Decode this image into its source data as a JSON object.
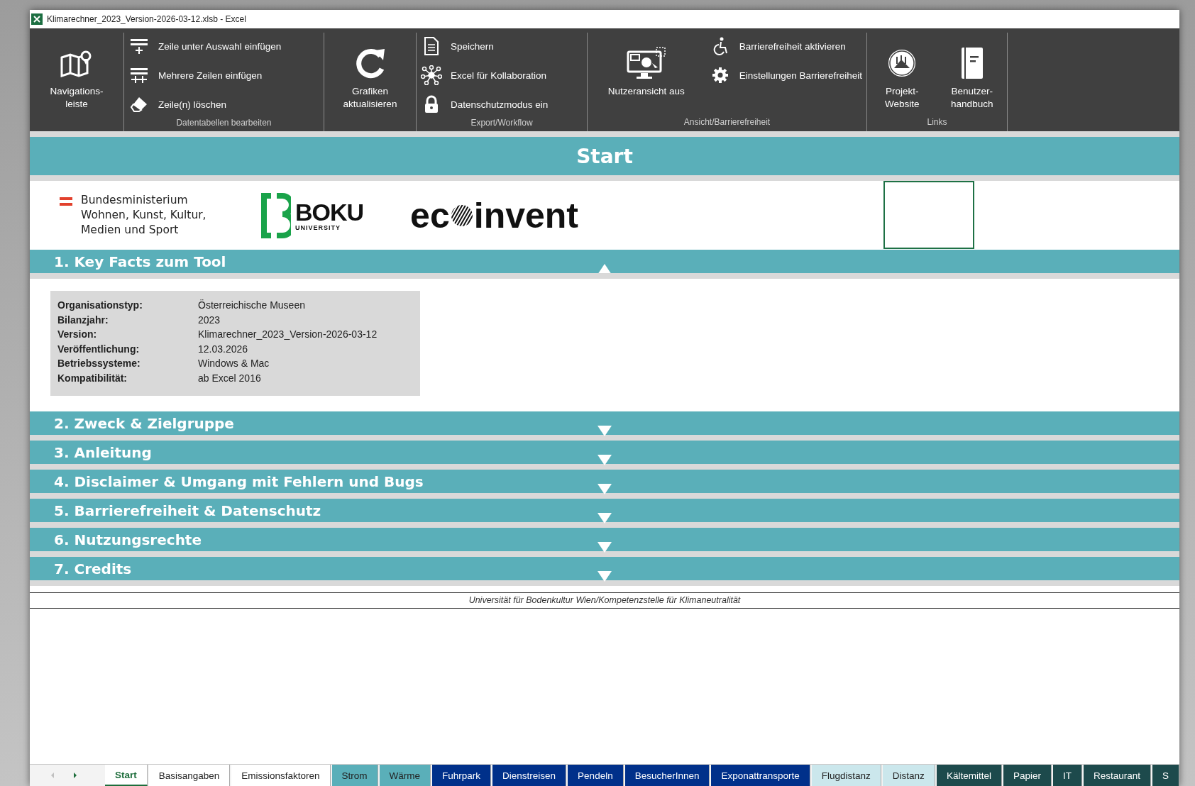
{
  "window": {
    "title": "Klimarechner_2023_Version-2026-03-12.xlsb - Excel"
  },
  "ribbon": {
    "groups": [
      {
        "buttons": [
          {
            "kind": "large",
            "label": "Navigations-\nleiste"
          }
        ]
      },
      {
        "label": "Datentabellen bearbeiten",
        "buttons": [
          {
            "kind": "small",
            "label": "Zeile unter Auswahl einfügen"
          },
          {
            "kind": "small",
            "label": "Mehrere Zeilen einfügen"
          },
          {
            "kind": "small",
            "label": "Zeile(n) löschen"
          }
        ]
      },
      {
        "buttons": [
          {
            "kind": "large",
            "label": "Grafiken\naktualisieren"
          }
        ]
      },
      {
        "label": "Export/Workflow",
        "buttons": [
          {
            "kind": "small",
            "label": "Speichern"
          },
          {
            "kind": "small",
            "label": "Excel für Kollaboration"
          },
          {
            "kind": "small",
            "label": "Datenschutzmodus ein"
          }
        ]
      },
      {
        "label": "Ansicht/Barrierefreiheit",
        "buttons": [
          {
            "kind": "large",
            "label": "Nutzeransicht aus"
          },
          {
            "kind": "small",
            "label": "Barrierefreiheit aktivieren"
          },
          {
            "kind": "small",
            "label": "Einstellungen Barrierefreiheit"
          }
        ]
      },
      {
        "label": "Links",
        "buttons": [
          {
            "kind": "large",
            "label": "Projekt-\nWebsite"
          },
          {
            "kind": "large",
            "label": "Benutzer-\nhandbuch"
          }
        ]
      }
    ]
  },
  "sheet": {
    "title": "Start",
    "logos": {
      "ministry": "Bundesministerium\nWohnen, Kunst, Kultur,\nMedien und Sport",
      "boku_name": "BOKU",
      "boku_sub": "UNIVERSITY",
      "ecoinvent_start": "ec",
      "ecoinvent_end": "invent"
    },
    "sections": [
      {
        "title": "1. Key Facts zum Tool",
        "expanded": true,
        "facts": [
          {
            "label": "Organisationstyp:",
            "value": "Österreichische Museen"
          },
          {
            "label": "Bilanzjahr:",
            "value": "2023"
          },
          {
            "label": "Version:",
            "value": "Klimarechner_2023_Version-2026-03-12"
          },
          {
            "label": "Veröffentlichung:",
            "value": "12.03.2026"
          },
          {
            "label": "Betriebssysteme:",
            "value": "Windows & Mac"
          },
          {
            "label": "Kompatibilität:",
            "value": "ab Excel 2016"
          }
        ]
      },
      {
        "title": "2. Zweck & Zielgruppe",
        "expanded": false
      },
      {
        "title": "3. Anleitung",
        "expanded": false
      },
      {
        "title": "4. Disclaimer & Umgang mit Fehlern und Bugs",
        "expanded": false
      },
      {
        "title": "5. Barrierefreiheit & Datenschutz",
        "expanded": false
      },
      {
        "title": "6. Nutzungsrechte",
        "expanded": false
      },
      {
        "title": "7. Credits",
        "expanded": false
      }
    ],
    "footer": "Universität für Bodenkultur Wien/Kompetenzstelle für Klimaneutralität"
  },
  "sheet_tabs": [
    {
      "label": "Start",
      "selected": true,
      "color": "#ffffff"
    },
    {
      "label": "Basisangaben",
      "selected": false,
      "color": "#ffffff"
    },
    {
      "label": "Emissionsfaktoren",
      "selected": false,
      "color": "#ffffff"
    },
    {
      "label": "Strom",
      "selected": false,
      "color": "#5aafb9"
    },
    {
      "label": "Wärme",
      "selected": false,
      "color": "#5aafb9"
    },
    {
      "label": "Fuhrpark",
      "selected": false,
      "color": "#00308a"
    },
    {
      "label": "Dienstreisen",
      "selected": false,
      "color": "#00308a"
    },
    {
      "label": "Pendeln",
      "selected": false,
      "color": "#00308a"
    },
    {
      "label": "BesucherInnen",
      "selected": false,
      "color": "#00308a"
    },
    {
      "label": "Exponattransporte",
      "selected": false,
      "color": "#00308a"
    },
    {
      "label": "Flugdistanz",
      "selected": false,
      "color": "#cbe7ec"
    },
    {
      "label": "Distanz",
      "selected": false,
      "color": "#cbe7ec"
    },
    {
      "label": "Kältemittel",
      "selected": false,
      "color": "#1d4a4c"
    },
    {
      "label": "Papier",
      "selected": false,
      "color": "#1d4a4c"
    },
    {
      "label": "IT",
      "selected": false,
      "color": "#1d4a4c"
    },
    {
      "label": "Restaurant",
      "selected": false,
      "color": "#1d4a4c"
    },
    {
      "label": "S",
      "selected": false,
      "color": "#1d4a4c"
    }
  ]
}
